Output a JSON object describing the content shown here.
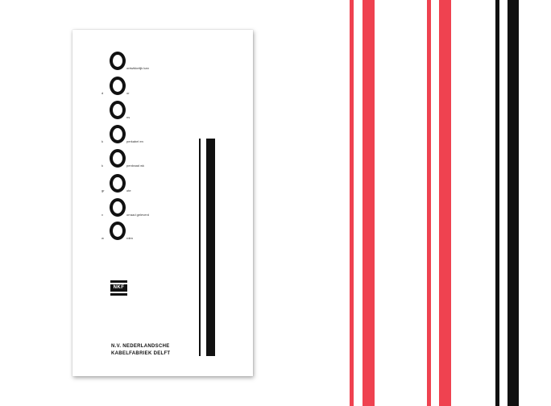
{
  "card": {
    "lines": [
      {
        "prefix": "",
        "suffix": "ontwikkelijk kan"
      },
      {
        "prefix": "d",
        "suffix": "or"
      },
      {
        "prefix": "",
        "suffix": "ns"
      },
      {
        "prefix": "k",
        "suffix": "perkabel en"
      },
      {
        "prefix": "k",
        "suffix": "perdraad wk"
      },
      {
        "prefix": "gr",
        "suffix": "ote"
      },
      {
        "prefix": "v",
        "suffix": "orraad geleverd"
      },
      {
        "prefix": "w",
        "suffix": "rden"
      }
    ],
    "logo_text": "NKF",
    "company_line1": "N.V. NEDERLANDSCHE",
    "company_line2": "KABELFABRIEK DELFT"
  },
  "colors": {
    "red": "#ef4250",
    "black": "#111111"
  }
}
